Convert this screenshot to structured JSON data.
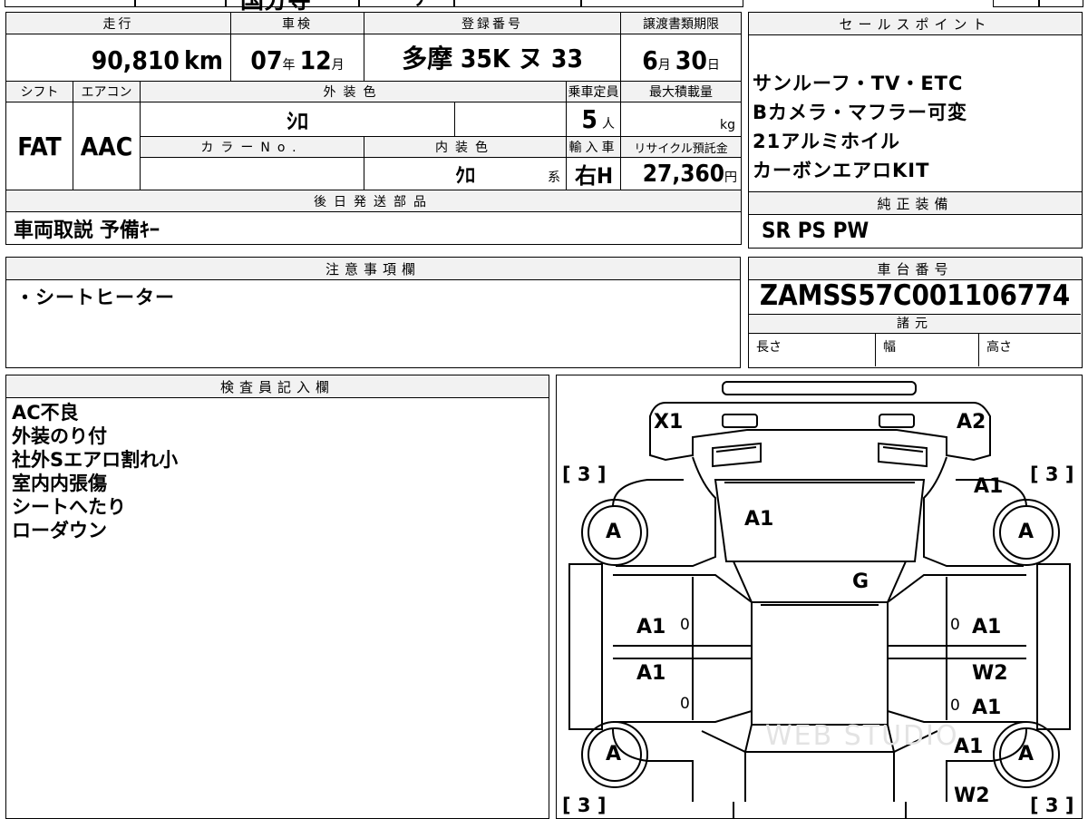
{
  "header_strip": {
    "partial_text": "国分寺",
    "partial_text2": "丿"
  },
  "vehicle": {
    "mileage_label": "走行",
    "mileage_value": "90,810",
    "mileage_unit": "km",
    "inspection_label": "車検",
    "inspection_year": "07",
    "inspection_year_unit": "年",
    "inspection_month": "12",
    "inspection_month_unit": "月",
    "registration_label": "登録番号",
    "registration_value": "多摩 35K ヌ 33",
    "transfer_label": "譲渡書類期限",
    "transfer_month": "6",
    "transfer_month_unit": "月",
    "transfer_day": "30",
    "transfer_day_unit": "日",
    "shift_label": "シフト",
    "shift_value": "FAT",
    "ac_label": "エアコン",
    "ac_value": "AAC",
    "exterior_color_label": "外装色",
    "exterior_color_value": "ｼﾛ",
    "capacity_label": "乗車定員",
    "capacity_value": "5",
    "capacity_unit": "人",
    "max_load_label": "最大積載量",
    "max_load_unit": "kg",
    "color_no_label": "カラーNo.",
    "interior_color_label": "内装色",
    "interior_color_value": "ｸﾛ",
    "interior_color_unit": "系",
    "import_label": "輸入車",
    "import_value": "右H",
    "recycle_label": "リサイクル預託金",
    "recycle_value": "27,360",
    "recycle_unit": "円",
    "later_parts_label": "後日発送部品",
    "later_parts_value": "車両取説  予備ｷｰ"
  },
  "sales_points": {
    "label": "セールスポイント",
    "lines": [
      "サンルーフ・TV・ETC",
      "Bカメラ・マフラー可変",
      "21アルミホイル",
      "カーボンエアロKIT"
    ]
  },
  "factory_equipment": {
    "label": "純正装備",
    "value": "SR PS PW"
  },
  "notes": {
    "label": "注意事項欄",
    "value": "・シートヒーター"
  },
  "chassis": {
    "label": "車台番号",
    "value": "ZAMSS57C001106774",
    "specs_label": "諸元",
    "length_label": "長さ",
    "width_label": "幅",
    "height_label": "高さ"
  },
  "inspector": {
    "label": "検査員記入欄",
    "lines": [
      "AC不良",
      "外装のり付",
      "社外Sエアロ割れ小",
      "室内内張傷",
      "シートへたり",
      "ローダウン"
    ]
  },
  "diagram": {
    "watermark": "WEB STUDIO",
    "tire_label": "A",
    "bracket_3": "[ 3 ]",
    "marks": {
      "x1": "X1",
      "a2": "A2",
      "a1_front_right": "A1",
      "a1_hood": "A1",
      "g_windshield": "G",
      "a1_front_door_left": "A1",
      "a1_rear_door_left": "A1",
      "a1_front_door_right": "A1",
      "w2_rear_door_right": "W2",
      "a1_rear_door_right": "A1",
      "a1_quarter_right": "A1",
      "w2_rear_right": "W2",
      "zero": "0"
    }
  }
}
